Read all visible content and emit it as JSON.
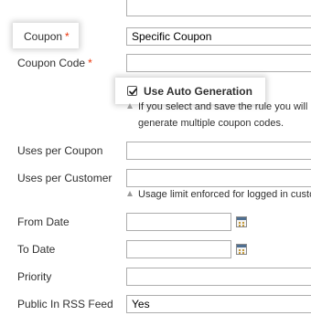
{
  "form": {
    "coupon": {
      "label": "Coupon",
      "required_mark": "*",
      "value": "Specific Coupon"
    },
    "coupon_code": {
      "label": "Coupon Code",
      "required_mark": "*",
      "value": ""
    },
    "auto_generation": {
      "label": "Use Auto Generation",
      "checked": true,
      "note_line1": "If you select and save the rule you will",
      "note_line2": "generate multiple coupon codes."
    },
    "uses_per_coupon": {
      "label": "Uses per Coupon",
      "value": ""
    },
    "uses_per_customer": {
      "label": "Uses per Customer",
      "value": "",
      "note": "Usage limit enforced for logged in custo"
    },
    "from_date": {
      "label": "From Date",
      "value": ""
    },
    "to_date": {
      "label": "To Date",
      "value": ""
    },
    "priority": {
      "label": "Priority",
      "value": ""
    },
    "public_rss": {
      "label": "Public In RSS Feed",
      "value": "Yes"
    }
  },
  "icons": {
    "note_marker": "triangle-up-icon",
    "date_picker": "calendar-icon",
    "checkbox_state": "checkmark-icon"
  },
  "colors": {
    "required": "#eb340a",
    "text": "#303030",
    "input_border": "#adadad"
  }
}
